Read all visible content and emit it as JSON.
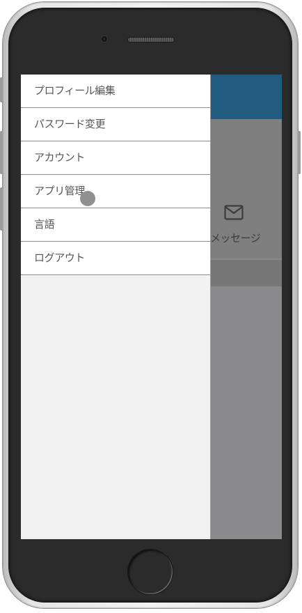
{
  "menu": {
    "items": [
      {
        "label": "プロフィール編集"
      },
      {
        "label": "パスワード変更"
      },
      {
        "label": "アカウント"
      },
      {
        "label": "アプリ管理"
      },
      {
        "label": "言語"
      },
      {
        "label": "ログアウト"
      }
    ]
  },
  "background": {
    "message_label": "メッセージ",
    "message_icon": "envelope-icon"
  },
  "colors": {
    "header": "#1f5c7f",
    "drawer_bg": "#f2f2f2",
    "overlay": "#8a8a8c"
  }
}
